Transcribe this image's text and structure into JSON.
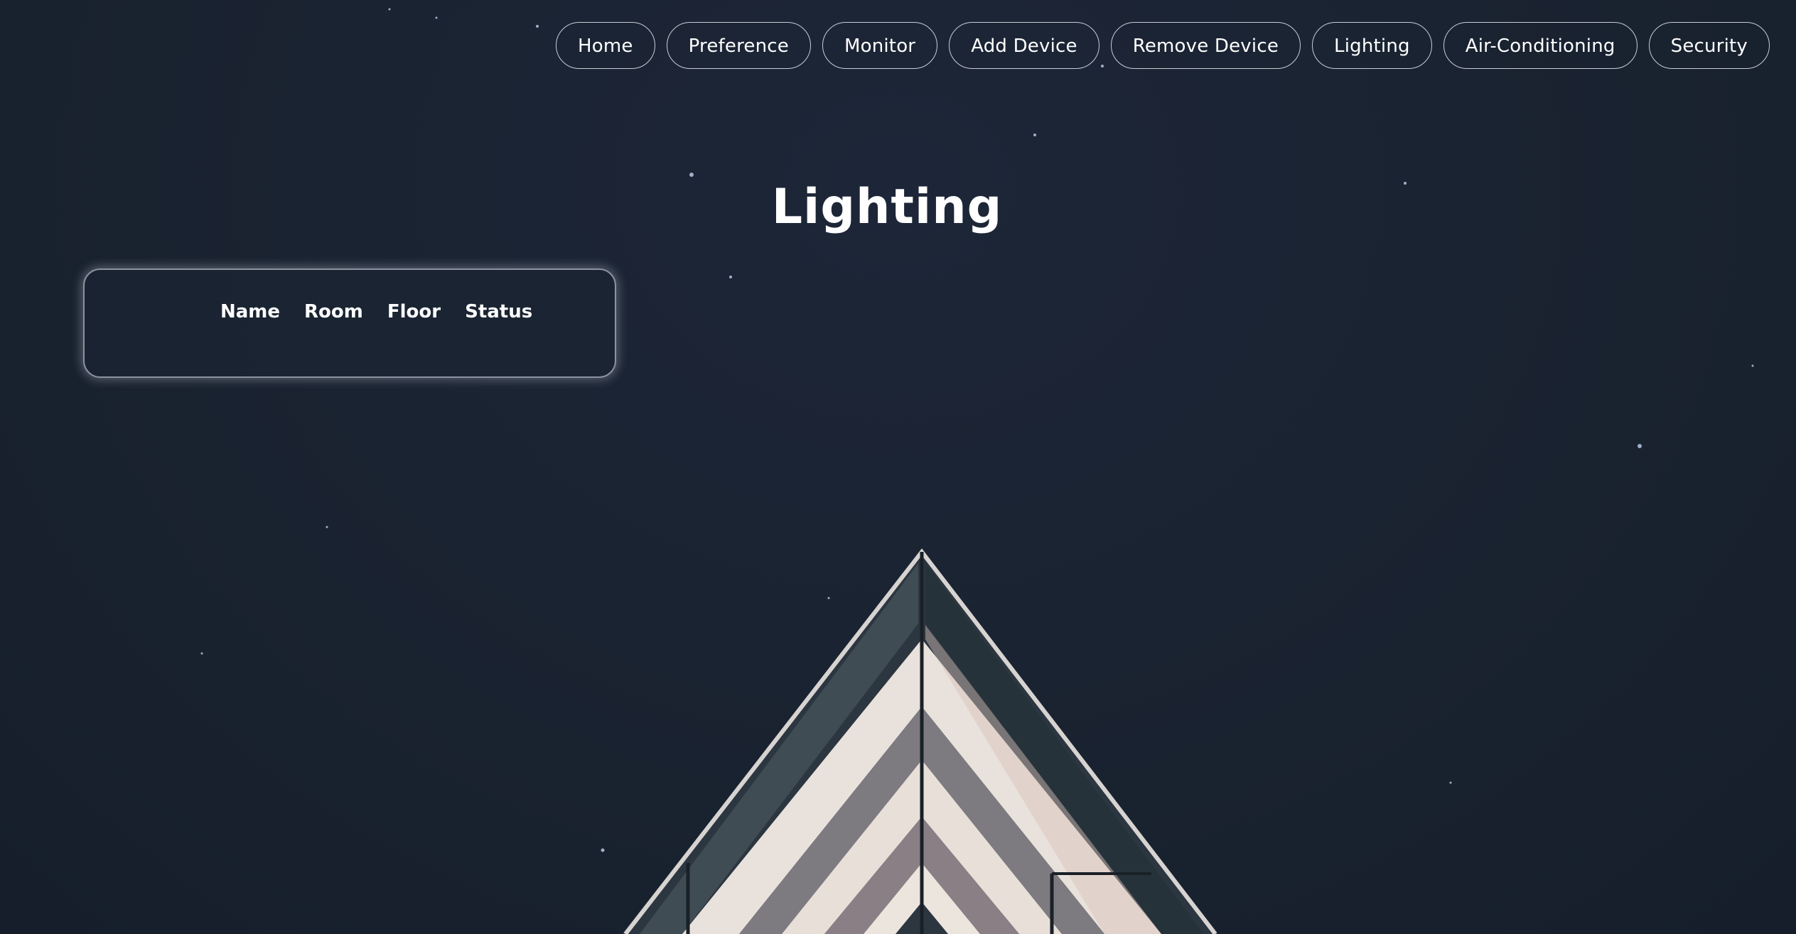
{
  "nav": {
    "items": [
      {
        "label": "Home"
      },
      {
        "label": "Preference"
      },
      {
        "label": "Monitor"
      },
      {
        "label": "Add Device"
      },
      {
        "label": "Remove Device"
      },
      {
        "label": "Lighting"
      },
      {
        "label": "Air-Conditioning"
      },
      {
        "label": "Security"
      }
    ]
  },
  "page": {
    "title": "Lighting"
  },
  "device_table": {
    "columns": [
      "Name",
      "Room",
      "Floor",
      "Status"
    ],
    "rows": []
  },
  "colors": {
    "background": "#1b2434",
    "text": "#ffffff",
    "border": "#c9ced6"
  }
}
